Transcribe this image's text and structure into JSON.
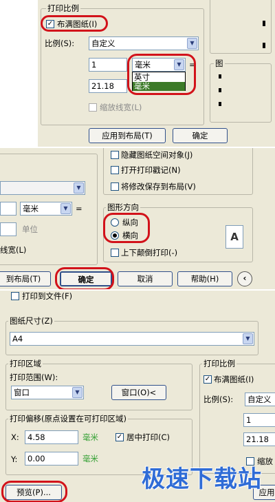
{
  "panel1": {
    "group_title": "打印比例",
    "fit_paper": "布满图纸(I)",
    "scale_label": "比例(S):",
    "scale_value": "自定义",
    "value_1": "1",
    "unit_value": "毫米",
    "unit_options": [
      "英寸",
      "毫米"
    ],
    "equals": "=",
    "value_2": "21.18",
    "scale_lineweights": "缩放线宽(L)",
    "apply_button": "应用到布局(T)",
    "ok_button": "确定",
    "right_group_char": "图"
  },
  "panel2": {
    "hide_paperspace": "隐藏图纸空间对象(J)",
    "plot_stamp": "打开打印戳记(N)",
    "save_changes": "将修改保存到布局(V)",
    "unit_value": "毫米",
    "equals": "=",
    "units_label": "单位",
    "lineweight_partial": "线宽(L)",
    "orientation_title": "图形方向",
    "portrait": "纵向",
    "landscape": "横向",
    "upside_down": "上下颠倒打印(-)",
    "orientation_icon_letter": "A",
    "apply_partial": "到布局(T)",
    "ok_button": "确定",
    "cancel_button": "取消",
    "help_button": "帮助(H)"
  },
  "panel3": {
    "print_to_file": "打印到文件(F)",
    "paper_size_title": "图纸尺寸(Z)",
    "paper_size_value": "A4",
    "plot_area_title": "打印区域",
    "plot_range_label": "打印范围(W):",
    "plot_range_value": "窗口",
    "window_button": "窗口(O)<",
    "plot_offset_title": "打印偏移(原点设置在可打印区域)",
    "x_label": "X:",
    "x_value": "4.58",
    "y_label": "Y:",
    "y_value": "0.00",
    "unit_mm": "毫米",
    "center_plot": "居中打印(C)",
    "scale_title": "打印比例",
    "fit_paper": "布满图纸(I)",
    "scale_label": "比例(S):",
    "scale_value": "自定义",
    "value_1": "1",
    "value_2": "21.18",
    "scale_partial": "缩放",
    "preview_button": "预览(P)...",
    "apply_partial": "应用"
  },
  "watermark": "极速下载站",
  "colors": {
    "annotation_red": "#d2121a",
    "dialog_bg": "#ece9d8",
    "highlight": "#3c7a28",
    "unit_green": "#33a033"
  }
}
